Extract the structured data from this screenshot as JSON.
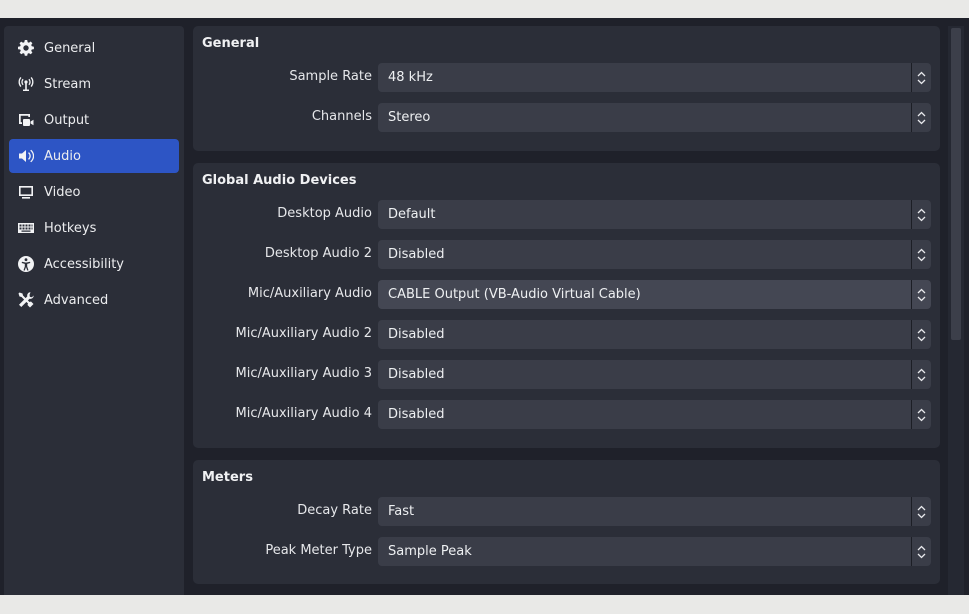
{
  "sidebar": {
    "items": [
      {
        "label": "General",
        "icon": "gear-icon",
        "active": false
      },
      {
        "label": "Stream",
        "icon": "antenna-icon",
        "active": false
      },
      {
        "label": "Output",
        "icon": "output-icon",
        "active": false
      },
      {
        "label": "Audio",
        "icon": "speaker-icon",
        "active": true
      },
      {
        "label": "Video",
        "icon": "monitor-icon",
        "active": false
      },
      {
        "label": "Hotkeys",
        "icon": "keyboard-icon",
        "active": false
      },
      {
        "label": "Accessibility",
        "icon": "accessibility-icon",
        "active": false
      },
      {
        "label": "Advanced",
        "icon": "tools-icon",
        "active": false
      }
    ]
  },
  "groups": {
    "general": {
      "title": "General",
      "rows": [
        {
          "label": "Sample Rate",
          "value": "48 kHz"
        },
        {
          "label": "Channels",
          "value": "Stereo"
        }
      ]
    },
    "global_audio": {
      "title": "Global Audio Devices",
      "rows": [
        {
          "label": "Desktop Audio",
          "value": "Default"
        },
        {
          "label": "Desktop Audio 2",
          "value": "Disabled"
        },
        {
          "label": "Mic/Auxiliary Audio",
          "value": "CABLE Output (VB-Audio Virtual Cable)"
        },
        {
          "label": "Mic/Auxiliary Audio 2",
          "value": "Disabled"
        },
        {
          "label": "Mic/Auxiliary Audio 3",
          "value": "Disabled"
        },
        {
          "label": "Mic/Auxiliary Audio 4",
          "value": "Disabled"
        }
      ]
    },
    "meters": {
      "title": "Meters",
      "rows": [
        {
          "label": "Decay Rate",
          "value": "Fast"
        },
        {
          "label": "Peak Meter Type",
          "value": "Sample Peak"
        }
      ]
    }
  },
  "colors": {
    "accent": "#2d55c5",
    "panel": "#2b2e38",
    "window": "#1f212a",
    "combo": "#3a3d48"
  }
}
